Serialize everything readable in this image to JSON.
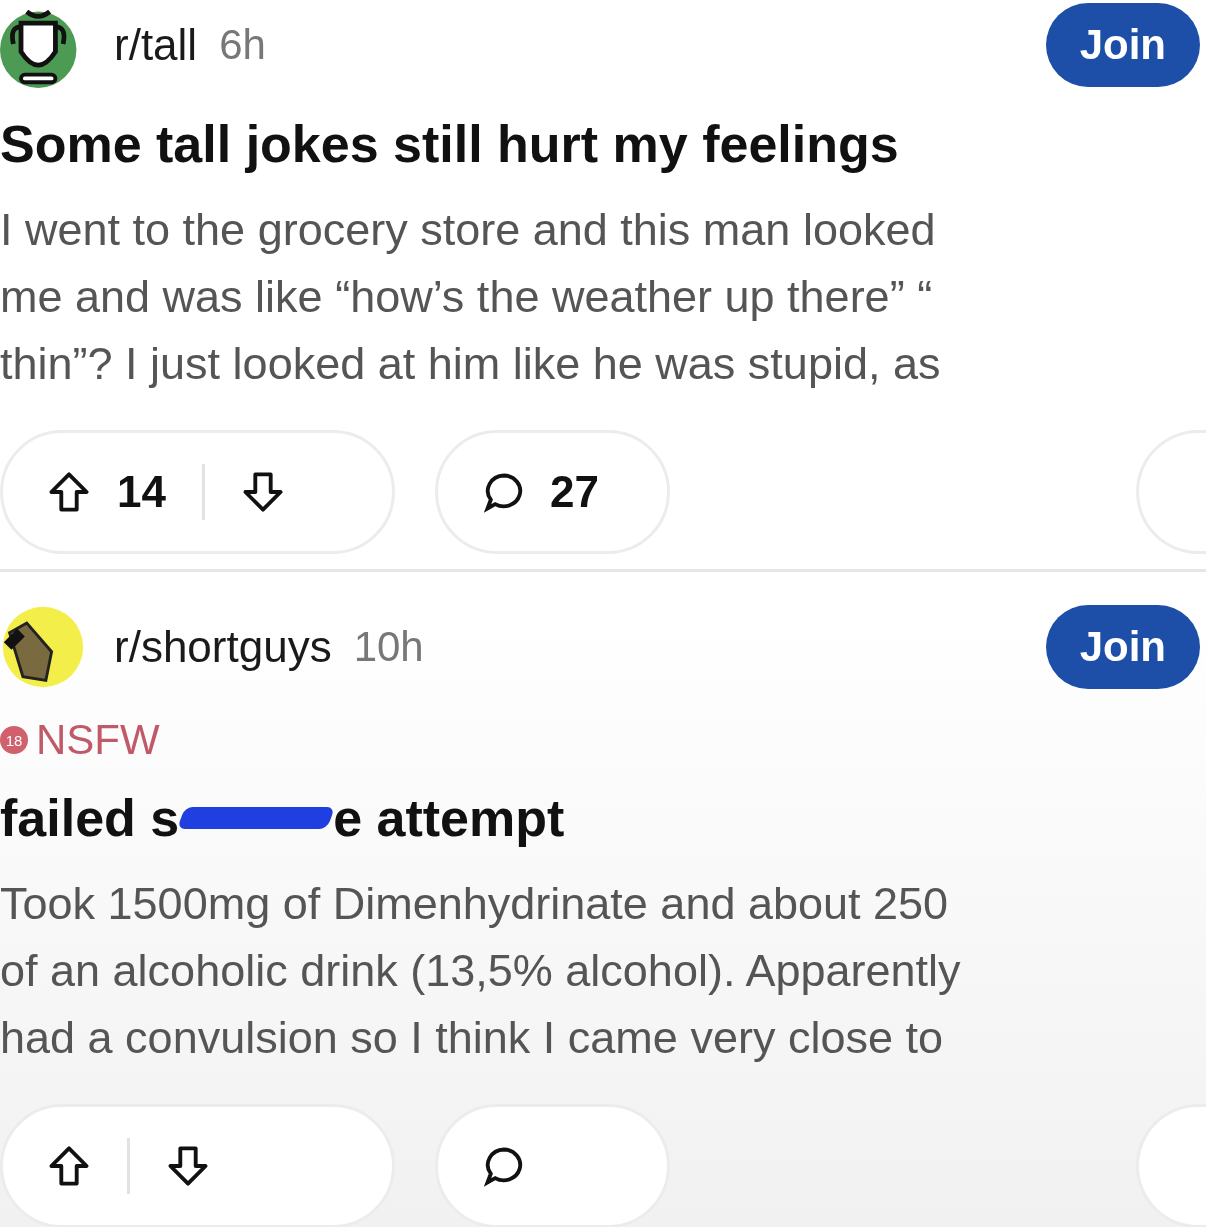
{
  "posts": [
    {
      "subreddit": "r/tall",
      "time": "6h",
      "avatar": {
        "kind": "trophy"
      },
      "join": "Join",
      "title": [
        {
          "kind": "text",
          "text": "Some tall jokes still hurt my feelings"
        }
      ],
      "body": [
        "I went to the grocery store and this man looked",
        "me and was like “how’s the weather up there” “",
        "thin”? I just looked at him like he was stupid, as"
      ],
      "upvotes": "14",
      "comments": "27"
    },
    {
      "subreddit": "r/shortguys",
      "time": "10h",
      "avatar": {
        "kind": "cartoon"
      },
      "join": "Join",
      "nsfw": {
        "badge": "18",
        "label": "NSFW"
      },
      "title": [
        {
          "kind": "text",
          "text": "failed s"
        },
        {
          "kind": "redaction"
        },
        {
          "kind": "text",
          "text": "e attempt"
        }
      ],
      "body": [
        "Took 1500mg of Dimenhydrinate and about 250",
        "of an alcoholic drink (13,5% alcohol). Apparently",
        "had a convulsion so I think I came very close to"
      ]
    }
  ]
}
